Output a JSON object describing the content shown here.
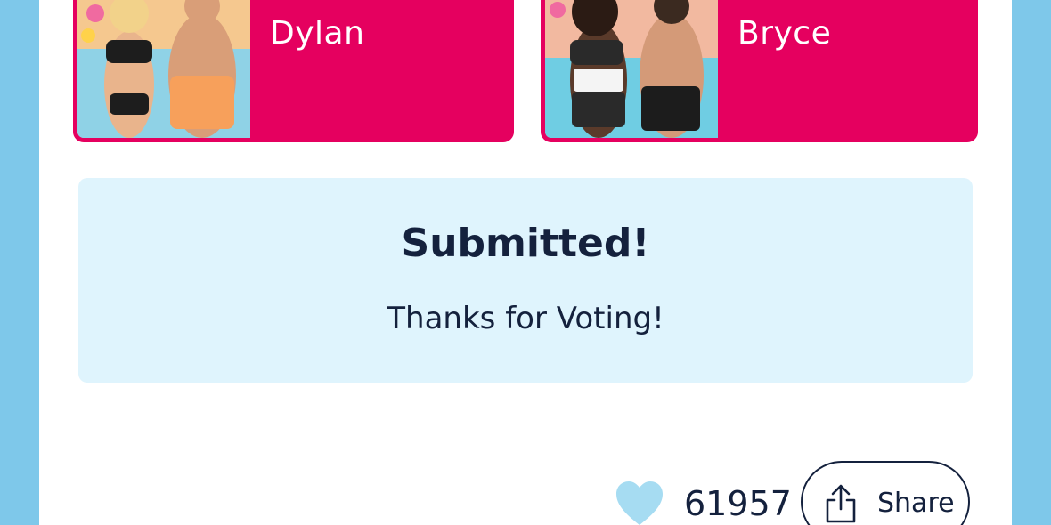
{
  "colors": {
    "page_background": "#7ec8ea",
    "card": "#e5005f",
    "result_background": "#dff4fd",
    "heart": "#a6dcf2",
    "text": "#14213d"
  },
  "couples": [
    {
      "name": "Dylan",
      "photo_icon": "couple-photo"
    },
    {
      "name": "Bryce",
      "photo_icon": "couple-photo"
    }
  ],
  "result": {
    "title": "Submitted!",
    "message": "Thanks for Voting!"
  },
  "likes": {
    "icon": "heart-icon",
    "count": "61957"
  },
  "share": {
    "icon": "share-icon",
    "label": "Share"
  }
}
